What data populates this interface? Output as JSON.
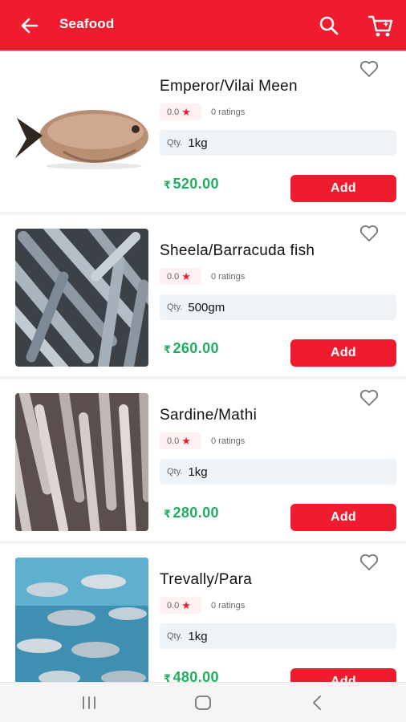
{
  "header": {
    "title": "Seafood",
    "icons": [
      "back-arrow-icon",
      "search-icon",
      "cart-icon"
    ],
    "color": "#ee1c2e"
  },
  "products": [
    {
      "name": "Emperor/Vilai Meen",
      "rating": "0.0",
      "ratings_count": "0 ratings",
      "qty_label": "Qty.",
      "qty": "1kg",
      "currency": "₹",
      "price": "520.00",
      "add_label": "Add"
    },
    {
      "name": "Sheela/Barracuda fish",
      "rating": "0.0",
      "ratings_count": "0 ratings",
      "qty_label": "Qty.",
      "qty": "500gm",
      "currency": "₹",
      "price": "260.00",
      "add_label": "Add"
    },
    {
      "name": "Sardine/Mathi",
      "rating": "0.0",
      "ratings_count": "0 ratings",
      "qty_label": "Qty.",
      "qty": "1kg",
      "currency": "₹",
      "price": "280.00",
      "add_label": "Add"
    },
    {
      "name": "Trevally/Para",
      "rating": "0.0",
      "ratings_count": "0 ratings",
      "qty_label": "Qty.",
      "qty": "1kg",
      "currency": "₹",
      "price": "480.00",
      "add_label": "Add"
    }
  ],
  "colors": {
    "accent": "#ee1c2e",
    "price": "#1fae5e",
    "qty_bg": "#eef3f7"
  },
  "system_nav": [
    "recent-apps-icon",
    "home-icon",
    "back-icon"
  ]
}
